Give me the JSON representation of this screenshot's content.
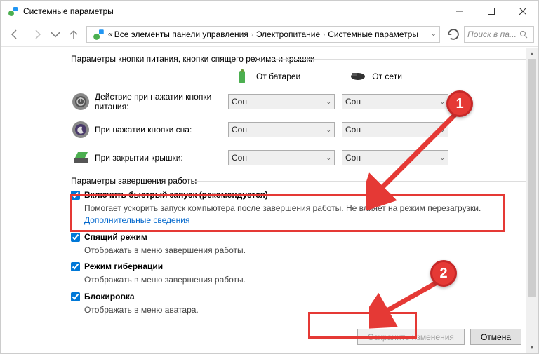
{
  "window": {
    "title": "Системные параметры"
  },
  "breadcrumbs": {
    "prefix": "«",
    "item1": "Все элементы панели управления",
    "item2": "Электропитание",
    "item3": "Системные параметры"
  },
  "search": {
    "placeholder": "Поиск в па..."
  },
  "section1": {
    "title": "Параметры кнопки питания, кнопки спящего режима и крышки"
  },
  "headers": {
    "battery": "От батареи",
    "plugged": "От сети"
  },
  "rows": {
    "power": {
      "label": "Действие при нажатии кнопки питания:",
      "bat": "Сон",
      "plug": "Сон"
    },
    "sleep": {
      "label": "При нажатии кнопки сна:",
      "bat": "Сон",
      "plug": "Сон"
    },
    "lid": {
      "label": "При закрытии крышки:",
      "bat": "Сон",
      "plug": "Сон"
    }
  },
  "section2": {
    "title": "Параметры завершения работы"
  },
  "options": {
    "fast": {
      "label": "Включить быстрый запуск (рекомендуется)",
      "desc": "Помогает ускорить запуск компьютера после завершения работы. Не влияет на режим перезагрузки.",
      "link": "Дополнительные сведения"
    },
    "sleepmode": {
      "label": "Спящий режим",
      "desc": "Отображать в меню завершения работы."
    },
    "hiber": {
      "label": "Режим гибернации",
      "desc": "Отображать в меню завершения работы."
    },
    "lock": {
      "label": "Блокировка",
      "desc": "Отображать в меню аватара."
    }
  },
  "buttons": {
    "save": "Сохранить изменения",
    "cancel": "Отмена"
  },
  "badges": {
    "one": "1",
    "two": "2"
  }
}
